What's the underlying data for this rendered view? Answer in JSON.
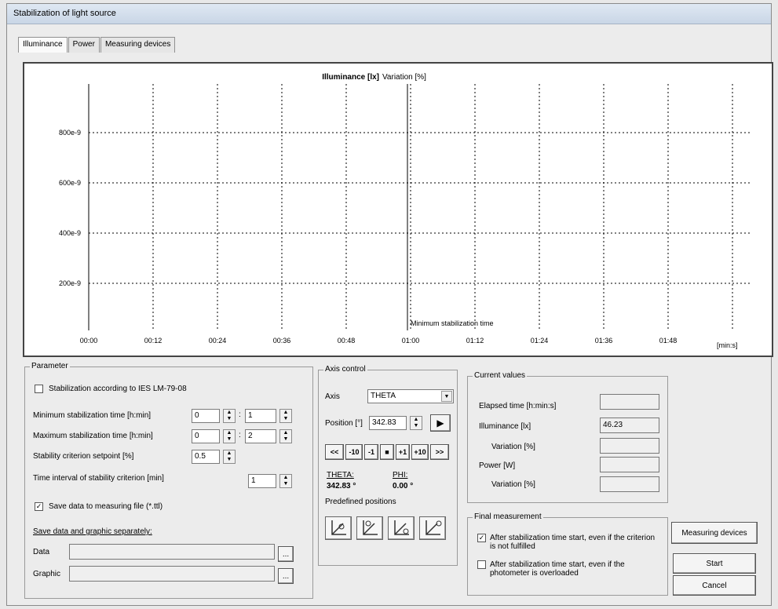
{
  "window": {
    "title": "Stabilization of light source"
  },
  "tabs": [
    {
      "label": "Illuminance"
    },
    {
      "label": "Power"
    },
    {
      "label": "Measuring devices"
    }
  ],
  "chart": {
    "title": "Illuminance [lx]",
    "title2": "Variation [%]",
    "annotation": "Minimum stabilization time",
    "x_unit": "[min:s]",
    "x_ticks": [
      "00:00",
      "00:12",
      "00:24",
      "00:36",
      "00:48",
      "01:00",
      "01:12",
      "01:24",
      "01:36",
      "01:48"
    ],
    "y_ticks": [
      "800e-9",
      "600e-9",
      "400e-9",
      "200e-9"
    ]
  },
  "chart_data": {
    "type": "line",
    "title": "Illuminance [lx]",
    "subtitle": "Variation [%]",
    "xlabel": "[min:s]",
    "ylabel": "",
    "x_ticks": [
      "00:00",
      "00:12",
      "00:24",
      "00:36",
      "00:48",
      "01:00",
      "01:12",
      "01:24",
      "01:36",
      "01:48"
    ],
    "y_ticks": [
      "200e-9",
      "400e-9",
      "600e-9",
      "800e-9"
    ],
    "series": [],
    "grid": true,
    "vertical_marker": {
      "x": "01:00",
      "label": "Minimum stabilization time"
    }
  },
  "parameter": {
    "title": "Parameter",
    "ies_label": "Stabilization according to IES LM-79-08",
    "ies_checked": false,
    "min_time_label": "Minimum stabilization time [h:min]",
    "min_time_h": "0",
    "min_time_min": "1",
    "max_time_label": "Maximum stabilization time [h:min]",
    "max_time_h": "0",
    "max_time_min": "2",
    "setpoint_label": "Stability criterion setpoint [%]",
    "setpoint": "0.5",
    "interval_label": "Time interval of stability criterion [min]",
    "interval": "1",
    "save_file_label": "Save data to measuring file (*.ttl)",
    "save_file_checked": true,
    "save_separately_label": "Save data and graphic separately:",
    "data_label": "Data",
    "graphic_label": "Graphic",
    "data_value": "",
    "graphic_value": "",
    "browse_label": "..."
  },
  "axis": {
    "title": "Axis control",
    "axis_label": "Axis",
    "axis_value": "THETA",
    "position_label": "Position [°]",
    "position_value": "342.83",
    "step_buttons": [
      "<<",
      "-10",
      "-1",
      "■",
      "+1",
      "+10",
      ">>"
    ],
    "theta_label": "THETA:",
    "theta_value": "342.83 °",
    "phi_label": "PHI:",
    "phi_value": "0.00 °",
    "predefined_label": "Predefined positions"
  },
  "current": {
    "title": "Current values",
    "elapsed_label": "Elapsed time [h:min:s]",
    "elapsed_value": "",
    "illuminance_label": "Illuminance [lx]",
    "illuminance_value": "46.23",
    "variation1_label": "Variation [%]",
    "variation1_value": "",
    "power_label": "Power [W]",
    "power_value": "",
    "variation2_label": "Variation [%]",
    "variation2_value": ""
  },
  "final": {
    "title": "Final measurement",
    "opt1_label": "After stabilization time start, even if the criterion is not fulfilled",
    "opt1_checked": true,
    "opt2_label": "After stabilization time start, even if the photometer is overloaded",
    "opt2_checked": false
  },
  "buttons": {
    "measuring_devices": "Measuring devices",
    "start": "Start",
    "cancel": "Cancel"
  }
}
